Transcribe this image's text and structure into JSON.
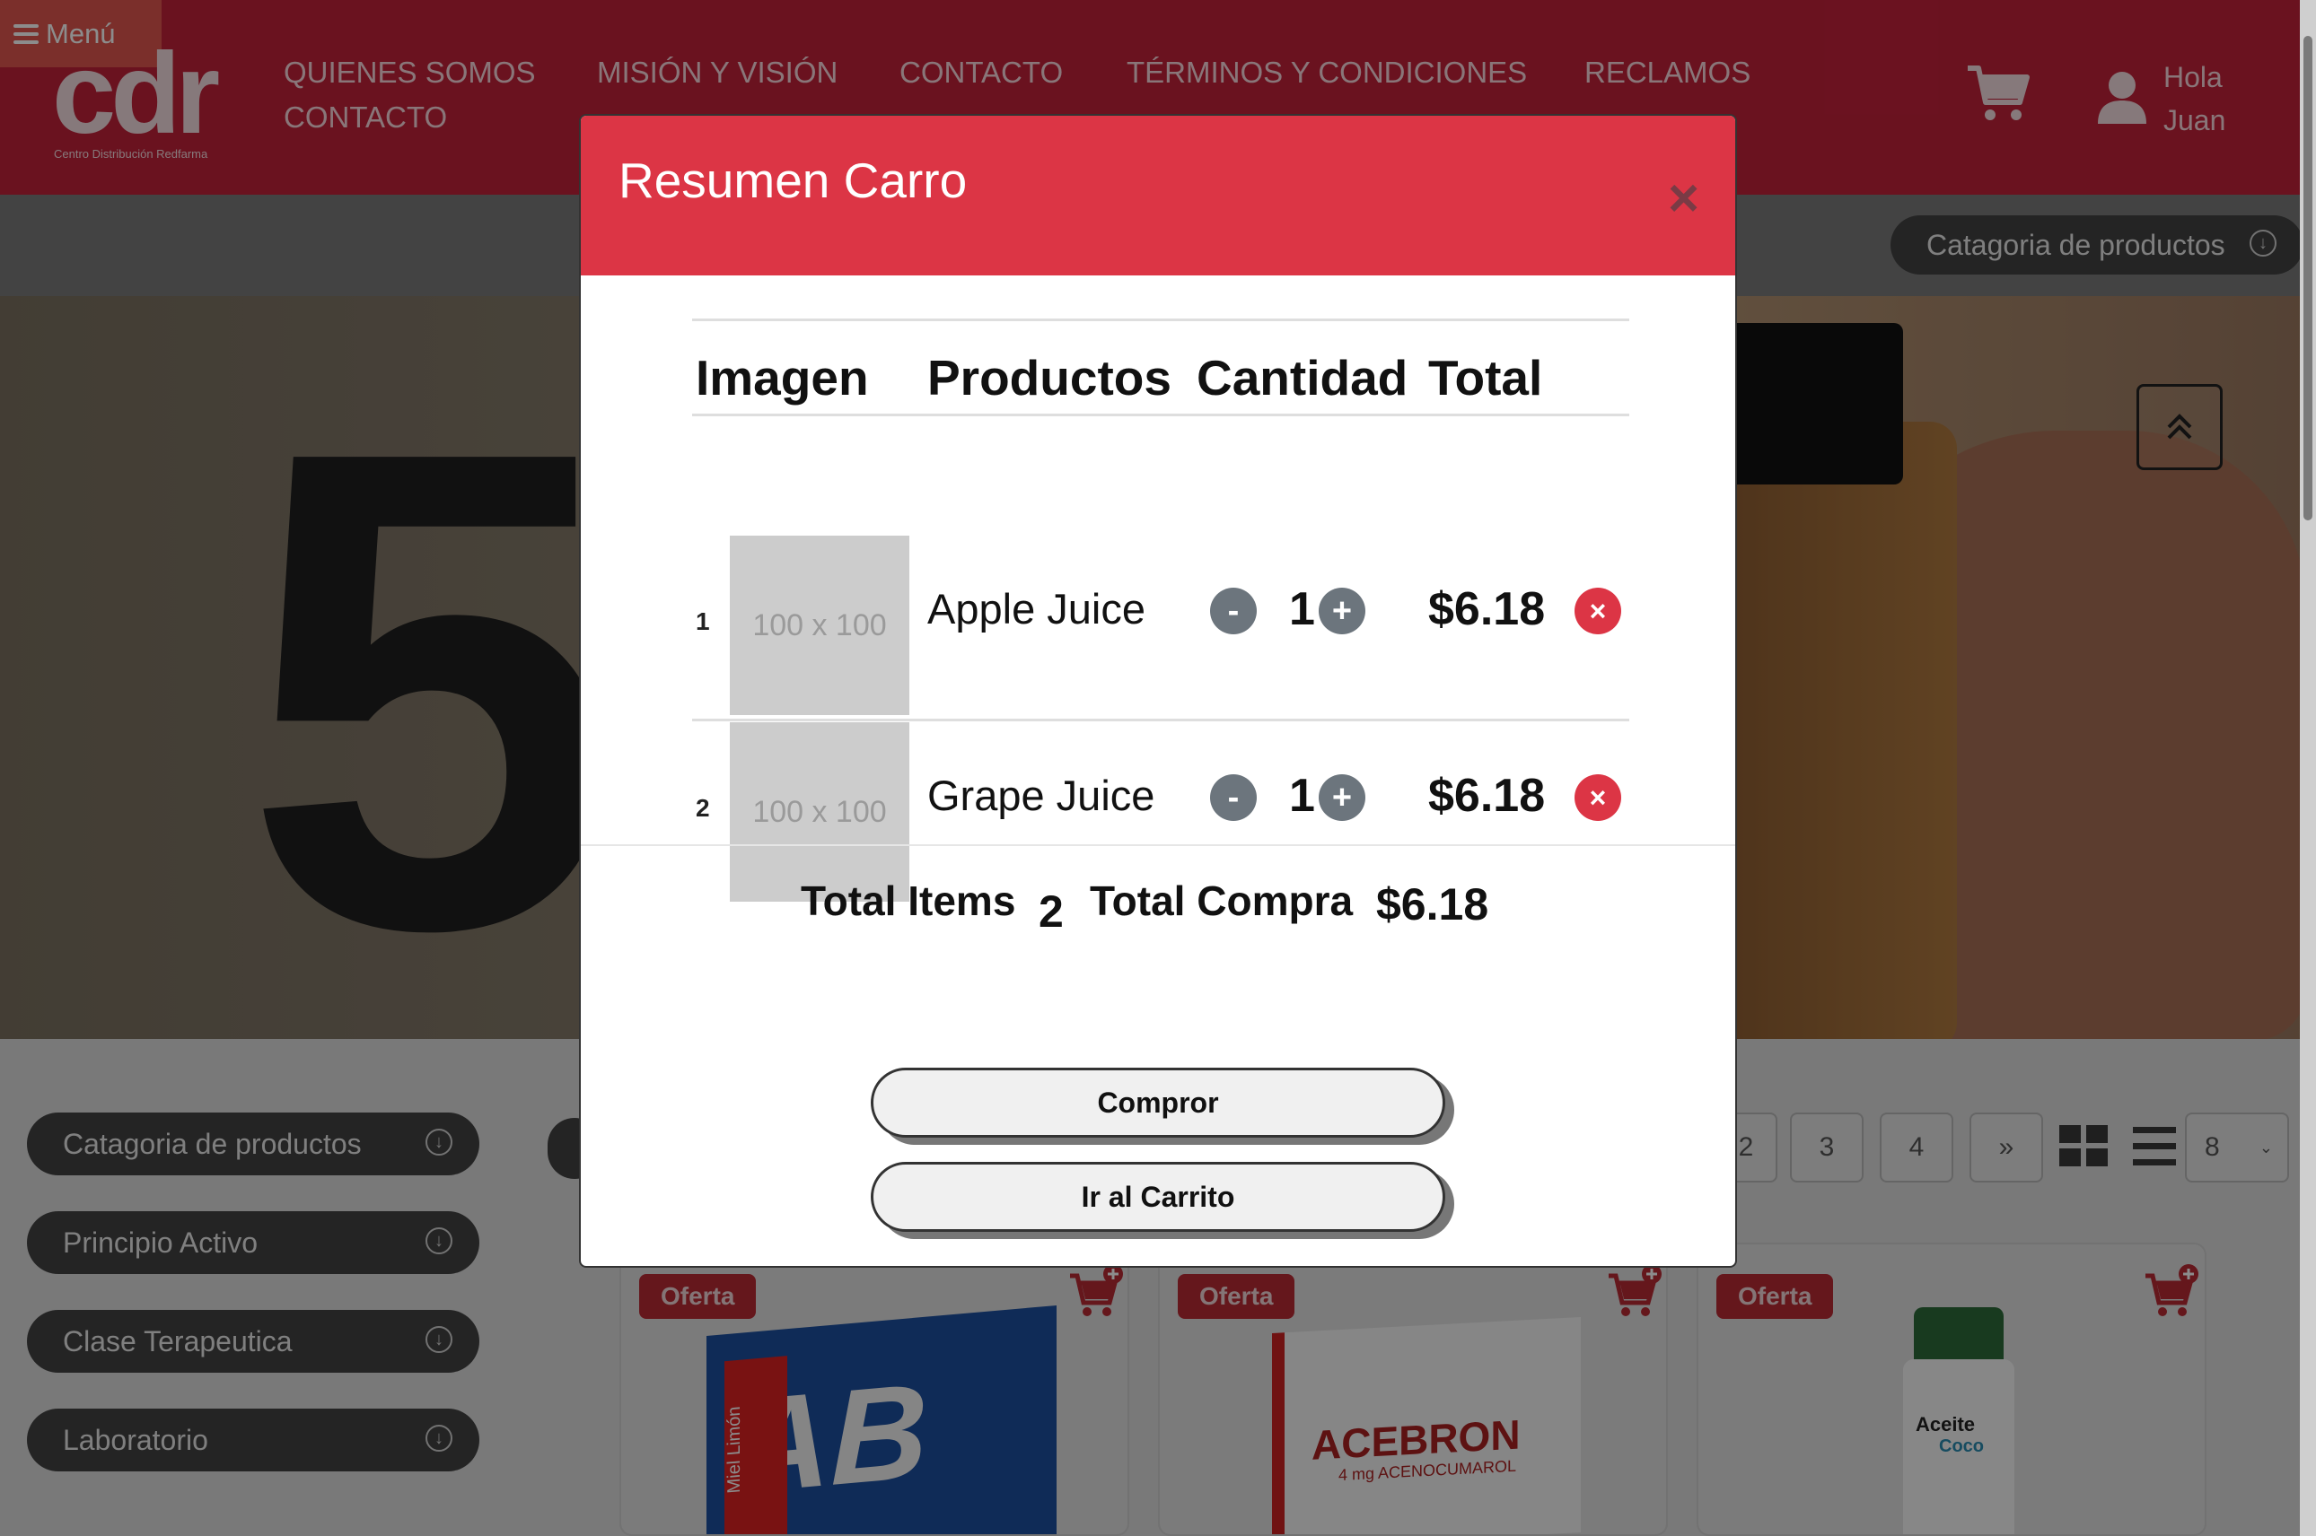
{
  "header": {
    "menu_label": "Menú",
    "logo_text": "cdr",
    "logo_subtitle": "Centro Distribución Redfarma",
    "nav": [
      {
        "label": "QUIENES SOMOS",
        "sub": "CONTACTO"
      },
      {
        "label": "MISIÓN Y VISIÓN"
      },
      {
        "label": "CONTACTO"
      },
      {
        "label": "TÉRMINOS Y CONDICIONES"
      },
      {
        "label": "RECLAMOS"
      }
    ],
    "greeting_line1": "Hola",
    "greeting_line2": "Juan"
  },
  "category_bar": {
    "label": "Catagoria de productos"
  },
  "sidebar_filters": [
    {
      "label": "Catagoria de productos"
    },
    {
      "label": "Principio Activo"
    },
    {
      "label": "Clase Terapeutica"
    },
    {
      "label": "Laboratorio"
    }
  ],
  "hero": {
    "text": "5"
  },
  "pagination": {
    "pages": [
      "2",
      "3",
      "4",
      "»"
    ],
    "per_page": "8"
  },
  "products": [
    {
      "badge": "Oferta",
      "box_text": "AB",
      "box_sub": "Miel Limón"
    },
    {
      "badge": "Oferta",
      "box_text": "ACEBRON",
      "box_sub": "4 mg ACENOCUMAROL"
    },
    {
      "badge": "Oferta",
      "box_text": "Aceite",
      "box_sub": "Coco"
    }
  ],
  "modal": {
    "title": "Resumen Carro",
    "close": "×",
    "columns": [
      "Imagen",
      "Productos",
      "Cantidad",
      "Total"
    ],
    "rows": [
      {
        "num": "1",
        "image_placeholder": "100 x 100",
        "product": "Apple Juice",
        "qty": "1",
        "total": "$6.18"
      },
      {
        "num": "2",
        "image_placeholder": "100 x 100",
        "product": "Grape Juice",
        "qty": "1",
        "total": "$6.18"
      }
    ],
    "minus": "-",
    "plus": "+",
    "remove": "×",
    "summary": {
      "items_label": "Total Items",
      "items_value": "2",
      "total_label": "Total Compra",
      "total_value": "$6.18"
    },
    "buy_label": "Compror",
    "cart_label": "Ir al Carrito"
  },
  "colors": {
    "header": "#c2213a",
    "modal_header": "#dc3545",
    "badge": "#b92a34"
  }
}
